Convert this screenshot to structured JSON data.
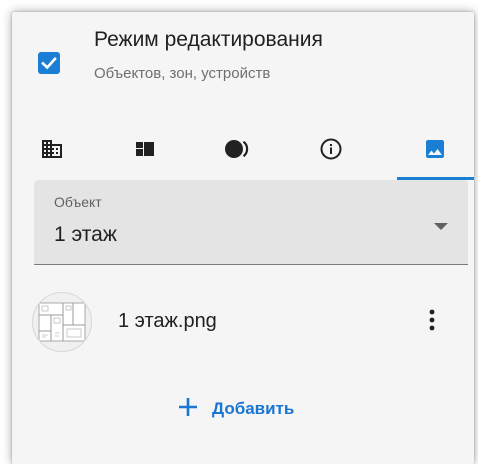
{
  "edit_mode": {
    "checked": true,
    "title": "Режим редактирования",
    "subtitle": "Объектов, зон, устройств"
  },
  "tabs": [
    {
      "icon": "building-icon",
      "active": false
    },
    {
      "icon": "dashboard-icon",
      "active": false
    },
    {
      "icon": "contrast-icon",
      "active": false
    },
    {
      "icon": "info-icon",
      "active": false
    },
    {
      "icon": "image-icon",
      "active": true
    }
  ],
  "object_select": {
    "label": "Объект",
    "value": "1 этаж"
  },
  "files": [
    {
      "name": "1 этаж.png"
    }
  ],
  "add_button": {
    "label": "Добавить"
  },
  "colors": {
    "accent": "#1a7fd4",
    "panel_bg": "#f5f5f5",
    "field_bg": "#e4e4e4"
  }
}
